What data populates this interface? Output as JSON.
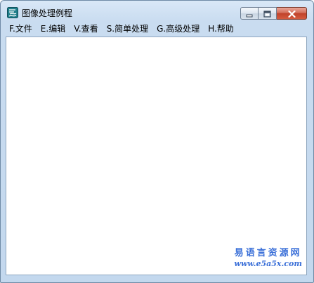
{
  "window": {
    "title": "图像处理例程",
    "icon": "app-logo-icon",
    "controls": {
      "minimize_icon": "minimize-icon",
      "maximize_icon": "maximize-icon",
      "close_icon": "close-icon"
    }
  },
  "menu": {
    "items": [
      {
        "label": "F.文件"
      },
      {
        "label": "E.编辑"
      },
      {
        "label": "V.查看"
      },
      {
        "label": "S.简单处理"
      },
      {
        "label": "G.高级处理"
      },
      {
        "label": "H.帮助"
      }
    ]
  },
  "watermark": {
    "text": "易语言资源网",
    "url": "www.e5a5x.com"
  },
  "colors": {
    "frame": "#c9dcf0",
    "close_button": "#c0432b",
    "watermark": "#3a6fd8"
  }
}
